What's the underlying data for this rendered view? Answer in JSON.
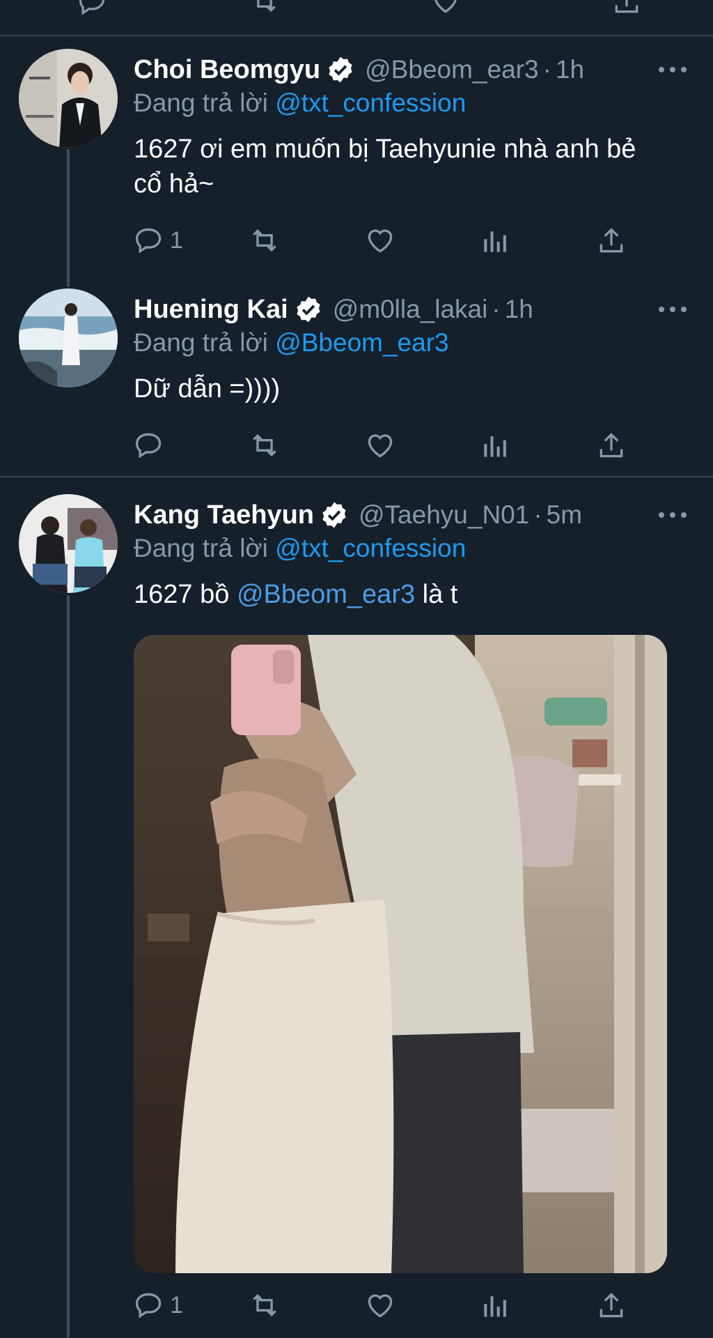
{
  "colors": {
    "background": "#15202b",
    "divider": "#38444d",
    "secondary_text": "#8899a6",
    "accent": "#1d9bf0",
    "verified": "#ffffff"
  },
  "tweets": [
    {
      "name": "Choi Beomgyu",
      "verified_icon": "verified-badge-icon",
      "handle": "@Bbeom_ear3",
      "separator": "·",
      "time": "1h",
      "replying_prefix": "Đang trả lời",
      "replying_to": "@txt_confession",
      "text": "1627 ơi em muốn bị Taehyunie nhà anh bẻ cổ hả~",
      "reply_count": "1",
      "retweet_count": "",
      "like_count": ""
    },
    {
      "name": "Huening Kai",
      "verified_icon": "verified-badge-icon",
      "handle": "@m0lla_lakai",
      "separator": "·",
      "time": "1h",
      "replying_prefix": "Đang trả lời",
      "replying_to": "@Bbeom_ear3",
      "text": "Dữ dẫn =))))",
      "reply_count": "",
      "retweet_count": "",
      "like_count": ""
    },
    {
      "name": "Kang Taehyun",
      "verified_icon": "verified-badge-icon",
      "handle": "@Taehyu_N01",
      "separator": "·",
      "time": "5m",
      "replying_prefix": "Đang trả lời",
      "replying_to": "@txt_confession",
      "text_prefix": "1627 bồ",
      "text_mention": "@Bbeom_ear3",
      "text_suffix": "là t",
      "reply_count": "1",
      "retweet_count": "",
      "like_count": ""
    }
  ],
  "icons": {
    "reply": "reply-bubble-icon",
    "retweet": "retweet-icon",
    "like": "heart-icon",
    "analytics": "analytics-bars-icon",
    "share": "share-upload-icon",
    "more": "more-dots-icon"
  }
}
